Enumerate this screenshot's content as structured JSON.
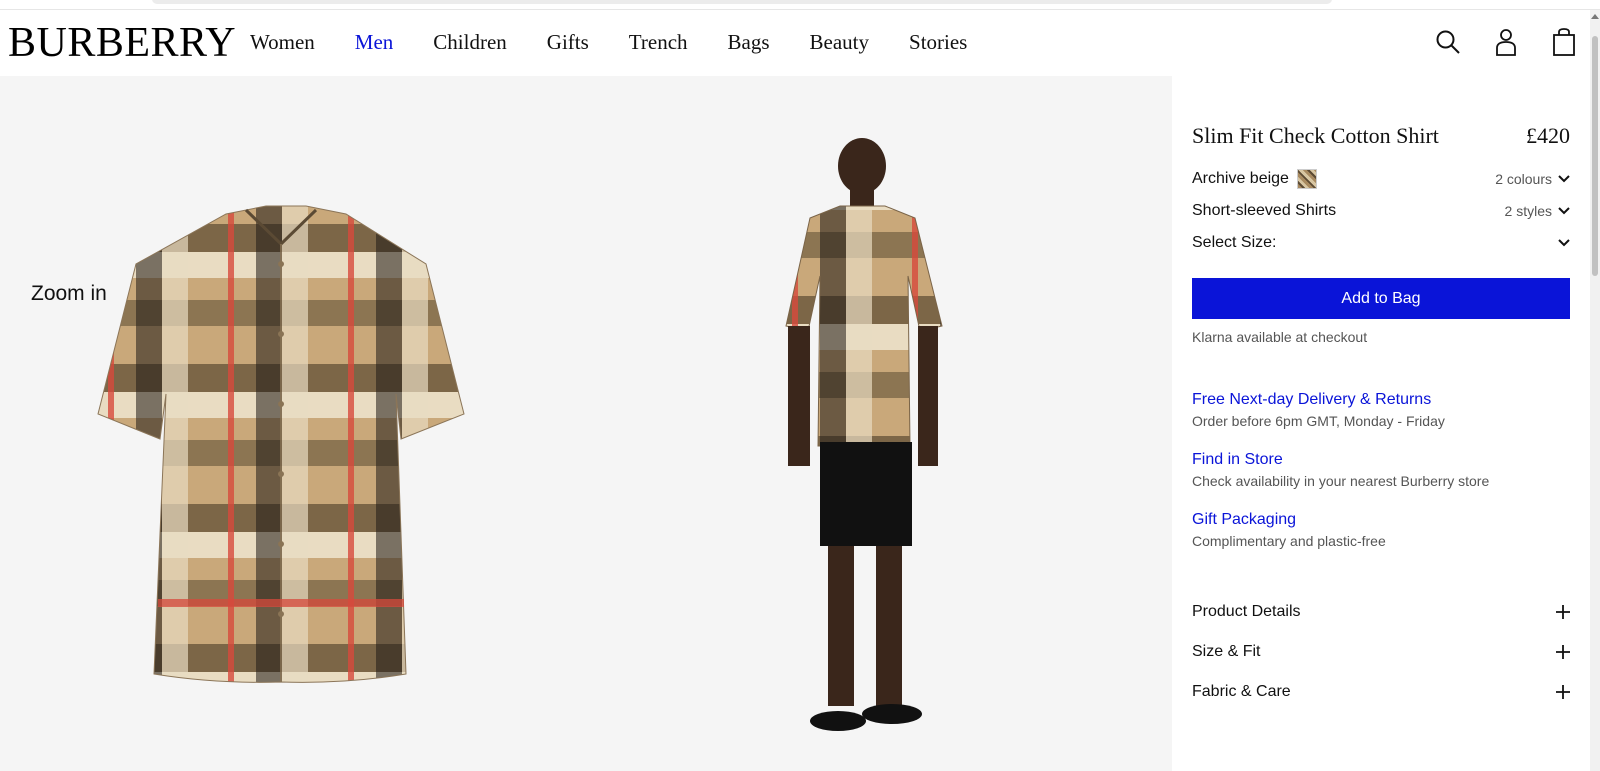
{
  "brand": {
    "logo": "BURBERRY"
  },
  "nav": {
    "items": [
      {
        "label": "Women"
      },
      {
        "label": "Men"
      },
      {
        "label": "Children"
      },
      {
        "label": "Gifts"
      },
      {
        "label": "Trench"
      },
      {
        "label": "Bags"
      },
      {
        "label": "Beauty"
      },
      {
        "label": "Stories"
      }
    ],
    "active": "Men"
  },
  "header_icons": [
    "search-icon",
    "account-icon",
    "bag-icon"
  ],
  "gallery": {
    "zoom_label": "Zoom in"
  },
  "product": {
    "title": "Slim Fit Check Cotton Shirt",
    "price": "£420",
    "colour": {
      "label": "Archive beige",
      "count": "2 colours"
    },
    "style": {
      "label": "Short-sleeved Shirts",
      "count": "2 styles"
    },
    "size": {
      "label": "Select Size:"
    },
    "add_to_bag": "Add to Bag",
    "klarna": "Klarna available at checkout"
  },
  "info": [
    {
      "link": "Free Next-day Delivery & Returns",
      "sub": "Order before 6pm GMT, Monday - Friday"
    },
    {
      "link": "Find in Store",
      "sub": "Check availability in your nearest Burberry store"
    },
    {
      "link": "Gift Packaging",
      "sub": "Complimentary and plastic-free"
    }
  ],
  "accordion": [
    {
      "label": "Product Details"
    },
    {
      "label": "Size & Fit"
    },
    {
      "label": "Fabric & Care"
    }
  ],
  "colors": {
    "accent": "#0a14d8",
    "gallery_bg": "#f5f5f5"
  }
}
